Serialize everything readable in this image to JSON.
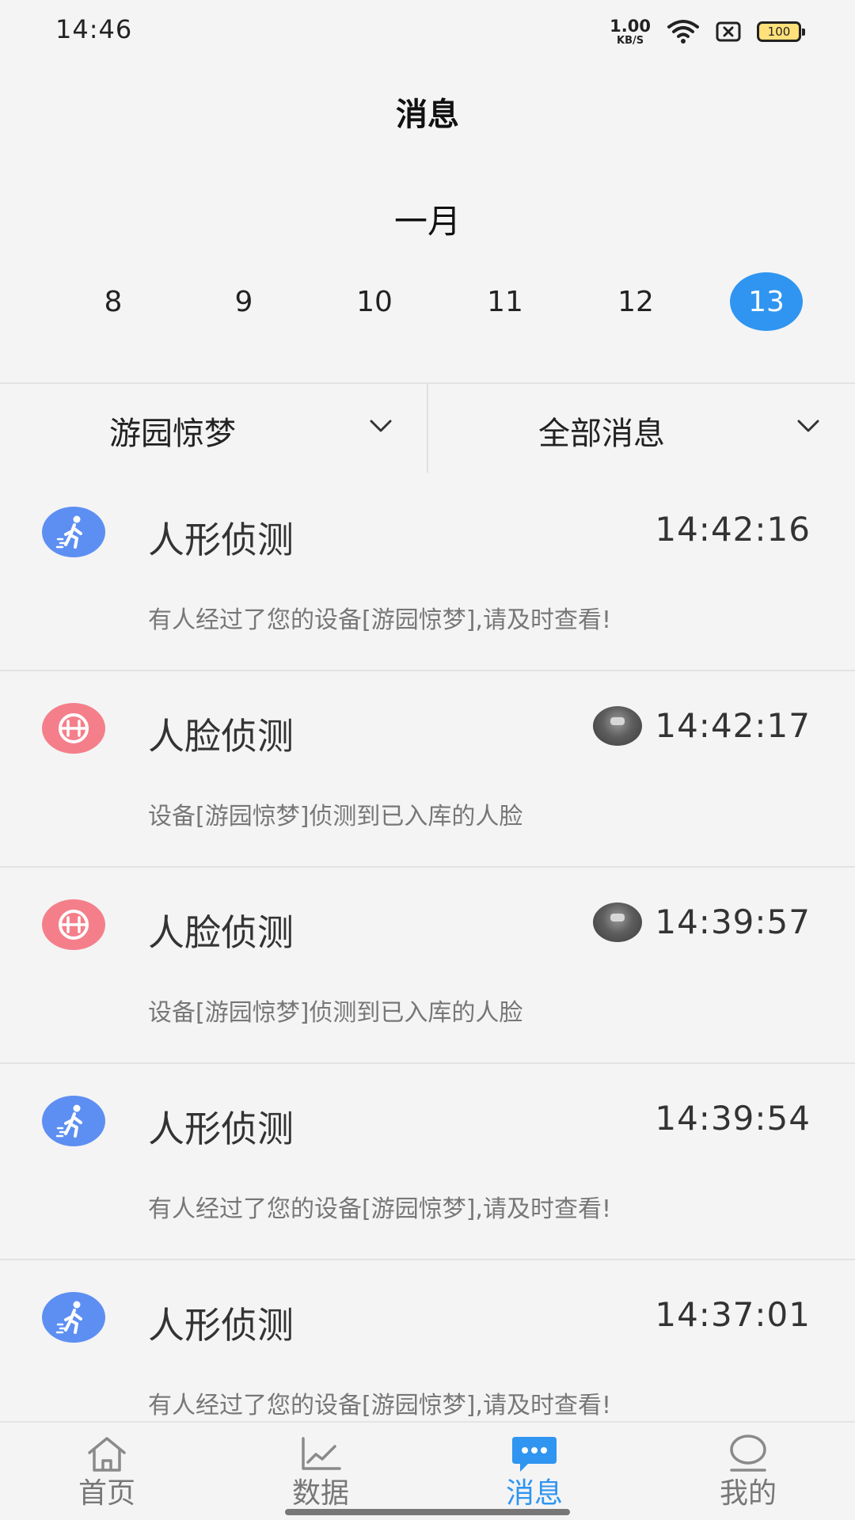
{
  "status": {
    "time": "14:46",
    "speed_value": "1.00",
    "speed_unit": "KB/S",
    "battery": "100"
  },
  "title": "消息",
  "month": "一月",
  "days": [
    {
      "label": "8",
      "selected": false
    },
    {
      "label": "9",
      "selected": false
    },
    {
      "label": "10",
      "selected": false
    },
    {
      "label": "11",
      "selected": false
    },
    {
      "label": "12",
      "selected": false
    },
    {
      "label": "13",
      "selected": true
    }
  ],
  "filters": {
    "device": "游园惊梦",
    "type": "全部消息"
  },
  "messages": [
    {
      "kind": "body",
      "title": "人形侦测",
      "time": "14:42:16",
      "has_thumb": false,
      "desc": "有人经过了您的设备[游园惊梦],请及时查看!"
    },
    {
      "kind": "face",
      "title": "人脸侦测",
      "time": "14:42:17",
      "has_thumb": true,
      "desc": "设备[游园惊梦]侦测到已入库的人脸"
    },
    {
      "kind": "face",
      "title": "人脸侦测",
      "time": "14:39:57",
      "has_thumb": true,
      "desc": "设备[游园惊梦]侦测到已入库的人脸"
    },
    {
      "kind": "body",
      "title": "人形侦测",
      "time": "14:39:54",
      "has_thumb": false,
      "desc": "有人经过了您的设备[游园惊梦],请及时查看!"
    },
    {
      "kind": "body",
      "title": "人形侦测",
      "time": "14:37:01",
      "has_thumb": false,
      "desc": "有人经过了您的设备[游园惊梦],请及时查看!"
    }
  ],
  "nav": [
    {
      "label": "首页",
      "icon": "home-icon",
      "active": false
    },
    {
      "label": "数据",
      "icon": "chart-icon",
      "active": false
    },
    {
      "label": "消息",
      "icon": "message-icon",
      "active": true
    },
    {
      "label": "我的",
      "icon": "profile-icon",
      "active": false
    }
  ],
  "colors": {
    "accent": "#2f95f0",
    "body_detect": "#5d8ff2",
    "face_detect": "#f47f8a"
  }
}
